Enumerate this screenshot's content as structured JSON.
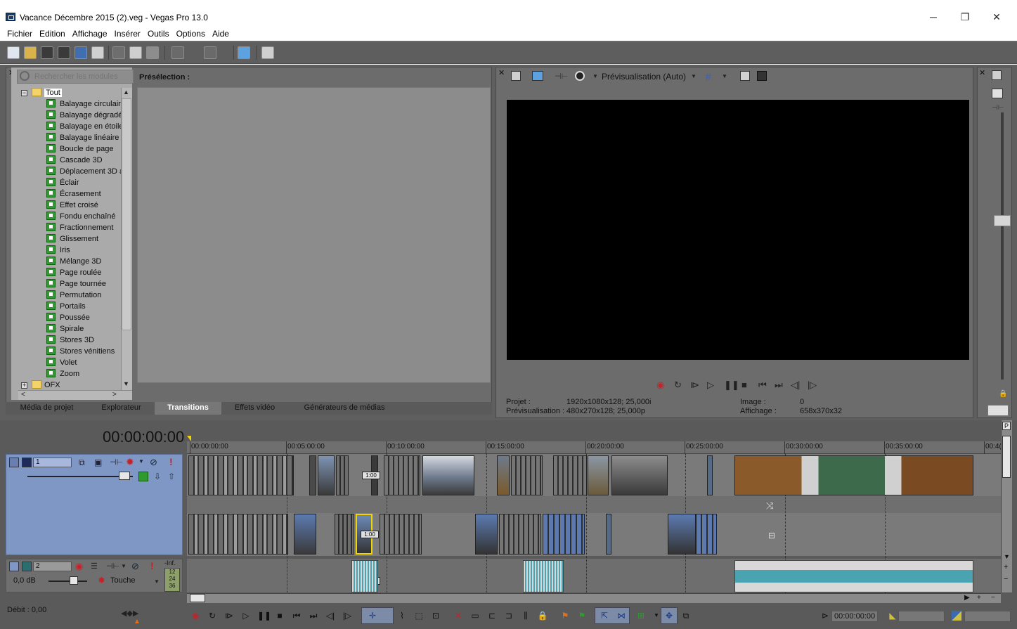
{
  "window": {
    "title": "Vacance Décembre 2015 (2).veg - Vegas Pro 13.0",
    "minimize": "─",
    "maximize": "❐",
    "close": "✕"
  },
  "menu": {
    "items": [
      "Fichier",
      "Edition",
      "Affichage",
      "Insérer",
      "Outils",
      "Options",
      "Aide"
    ]
  },
  "toolbar": {
    "icons": [
      "new-icon",
      "open-icon",
      "save-icon",
      "save-as-icon",
      "render-icon",
      "properties-icon",
      "cut-icon",
      "copy-icon",
      "paste-icon",
      "undo-icon",
      "redo-icon",
      "trim-icon",
      "normal-edit-icon"
    ]
  },
  "modules": {
    "search_placeholder": "Rechercher les modules",
    "root_label": "Tout",
    "items": [
      "Balayage circulaire",
      "Balayage dégradé",
      "Balayage en étoile",
      "Balayage linéaire",
      "Boucle de page",
      "Cascade 3D",
      "Déplacement 3D a",
      "Éclair",
      "Écrasement",
      "Effet croisé",
      "Fondu enchaîné",
      "Fractionnement",
      "Glissement",
      "Iris",
      "Mélange 3D",
      "Page roulée",
      "Page tournée",
      "Permutation",
      "Portails",
      "Poussée",
      "Spirale",
      "Stores 3D",
      "Stores vénitiens",
      "Volet",
      "Zoom"
    ],
    "ofx_label": "OFX"
  },
  "preset": {
    "label": "Présélection :"
  },
  "tabs": [
    "Média de projet",
    "Explorateur",
    "Transitions",
    "Effets vidéo",
    "Générateurs de médias"
  ],
  "active_tab": "Transitions",
  "preview": {
    "mode_label": "Prévisualisation (Auto)",
    "info": {
      "project_key": "Projet :",
      "project_val": "1920x1080x128; 25,000i",
      "preview_key": "Prévisualisation :",
      "preview_val": "480x270x128; 25,000p",
      "image_key": "Image :",
      "image_val": "0",
      "display_key": "Affichage :",
      "display_val": "658x370x32"
    }
  },
  "timeline": {
    "time": "00:00:00:00",
    "ruler_labels": [
      "00:00:00:00",
      "00:05:00:00",
      "00:10:00:00",
      "00:15:00:00",
      "00:20:00:00",
      "00:25:00:00",
      "00:30:00:00",
      "00:35:00:00",
      "00:4("
    ],
    "track1": {
      "number": "1"
    },
    "track2": {
      "number": "2",
      "volume": "0,0 dB",
      "mode": "Touche",
      "meter_inf": "-Inf.",
      "meter_vals": [
        "12",
        "24",
        "36"
      ]
    },
    "transition_label": "1:00",
    "status": "Débit : 0,00",
    "out_time": "00:00:00:00"
  },
  "colors": {
    "panel_bg": "#6c6c6c",
    "track1_header": "#7e97c5",
    "waveform": "#4aa3b0",
    "record_red": "#c0242a"
  }
}
